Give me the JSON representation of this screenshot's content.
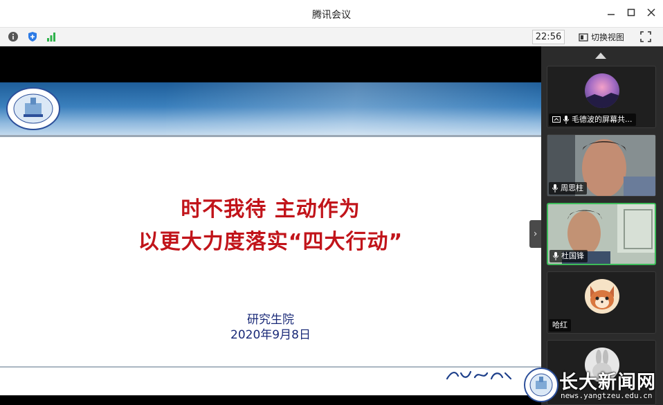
{
  "window": {
    "title": "腾讯会议"
  },
  "toolbar": {
    "time": "22:56",
    "switch_view_label": "切换视图"
  },
  "slide": {
    "title_line1": "时不我待  主动作为",
    "title_line2": "以更大力度落实“四大行动”",
    "department": "研究生院",
    "date": "2020年9月8日"
  },
  "participants": [
    {
      "name": "毛德波的屏幕共...",
      "type": "screen-share"
    },
    {
      "name": "周思柱",
      "type": "video"
    },
    {
      "name": "杜国锋",
      "type": "video",
      "active": true
    },
    {
      "name": "哈红",
      "type": "avatar"
    },
    {
      "name": "",
      "type": "avatar"
    }
  ],
  "watermark": {
    "brand": "长大新闻网",
    "url": "news.yangtzeu.edu.cn"
  },
  "colors": {
    "title_red": "#c1141a",
    "sub_blue": "#1a2a78",
    "active_border": "#3dbc5a",
    "signal_green": "#2fb24b",
    "shield_blue": "#2d7be5"
  }
}
